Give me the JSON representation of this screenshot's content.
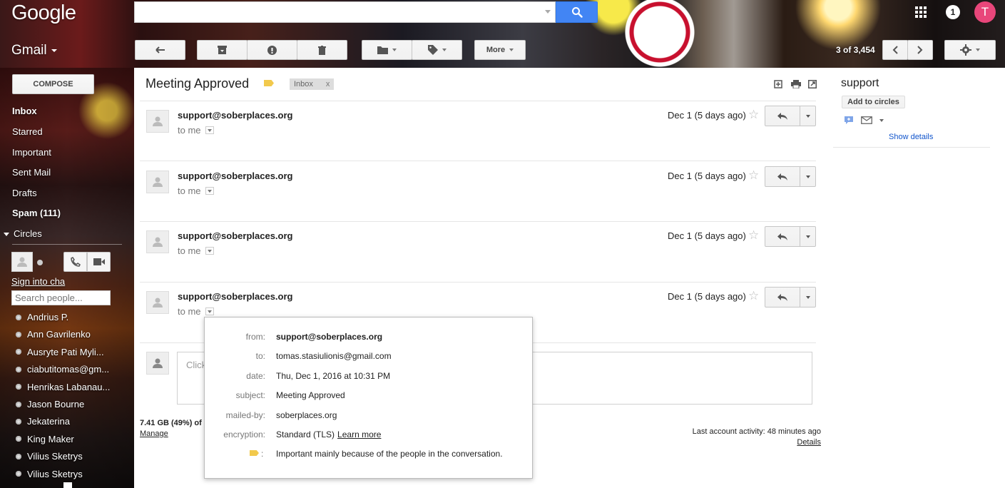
{
  "header": {
    "logo": "Google",
    "app_label": "Gmail",
    "search_value": "",
    "notifications_count": "1",
    "account_initial": "T"
  },
  "toolbar": {
    "more_label": "More",
    "counter": "3 of 3,454"
  },
  "nav": {
    "compose_label": "COMPOSE",
    "items": [
      {
        "label": "Inbox",
        "bold": true
      },
      {
        "label": "Starred",
        "bold": false
      },
      {
        "label": "Important",
        "bold": false
      },
      {
        "label": "Sent Mail",
        "bold": false
      },
      {
        "label": "Drafts",
        "bold": false
      },
      {
        "label": "Spam (111)",
        "bold": true
      }
    ],
    "circles_label": "Circles",
    "sign_in_label": "Sign into cha",
    "search_people_placeholder": "Search people...",
    "contacts": [
      "Andrius P.",
      "Ann Gavrilenko",
      "Ausryte Pati Myli...",
      "ciabutitomas@gm...",
      "Henrikas Labanau...",
      "Jason Bourne",
      "Jekaterina",
      "King Maker",
      "Vilius Sketrys",
      "Vilius Sketrys"
    ]
  },
  "thread": {
    "subject": "Meeting Approved",
    "label_chip": "Inbox",
    "label_chip_close": "x",
    "messages": [
      {
        "sender": "support@soberplaces.org",
        "to": "to me",
        "date": "Dec 1 (5 days ago)"
      },
      {
        "sender": "support@soberplaces.org",
        "to": "to me",
        "date": "Dec 1 (5 days ago)"
      },
      {
        "sender": "support@soberplaces.org",
        "to": "to me",
        "date": "Dec 1 (5 days ago)"
      },
      {
        "sender": "support@soberplaces.org",
        "to": "to me",
        "date": "Dec 1 (5 days ago)"
      }
    ],
    "reply_placeholder": "Click"
  },
  "details_popover": {
    "from_key": "from:",
    "from_val": "support@soberplaces.org",
    "to_key": "to:",
    "to_val": "tomas.stasiulionis@gmail.com",
    "date_key": "date:",
    "date_val": "Thu, Dec 1, 2016 at 10:31 PM",
    "subject_key": "subject:",
    "subject_val": "Meeting Approved",
    "mailedby_key": "mailed-by:",
    "mailedby_val": "soberplaces.org",
    "encryption_key": "encryption:",
    "encryption_val": "Standard (TLS)",
    "learn_more": "Learn more",
    "importance_colon": ":",
    "importance_val": "Important mainly because of the people in the conversation."
  },
  "footer": {
    "storage": "7.41 GB (49%) of",
    "manage": "Manage",
    "activity": "Last account activity: 48 minutes ago",
    "details": "Details"
  },
  "right_panel": {
    "name": "support",
    "add_to_circles": "Add to circles",
    "show_details": "Show details"
  },
  "colors": {
    "search_button": "#4285f4",
    "avatar": "#e8467a",
    "label_tag": "#f2c94c",
    "link": "#1155cc"
  }
}
